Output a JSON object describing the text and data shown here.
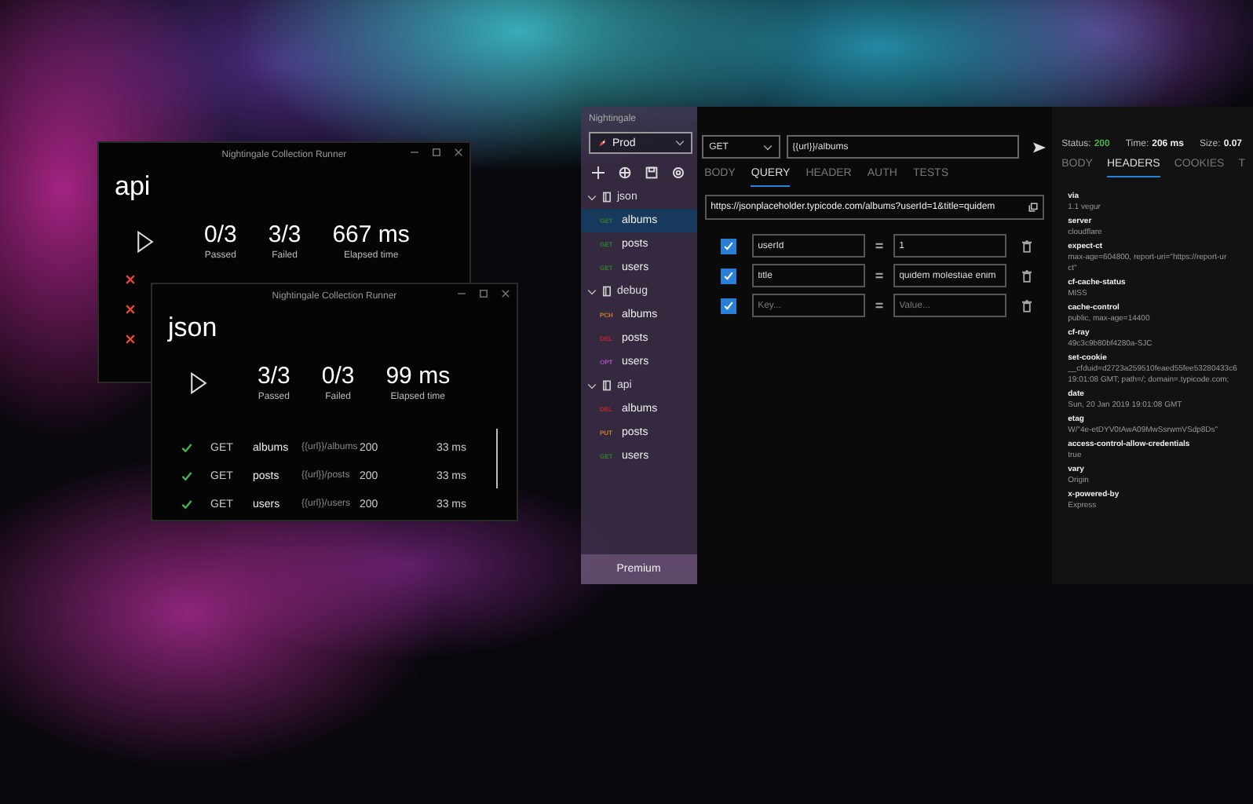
{
  "runners": [
    {
      "title": "Nightingale Collection Runner",
      "name": "api",
      "stats": [
        {
          "value": "0/3",
          "label": "Passed"
        },
        {
          "value": "3/3",
          "label": "Failed"
        },
        {
          "value": "667 ms",
          "label": "Elapsed time"
        }
      ],
      "results": [
        {
          "passed": false
        },
        {
          "passed": false
        },
        {
          "passed": false
        }
      ]
    },
    {
      "title": "Nightingale Collection Runner",
      "name": "json",
      "stats": [
        {
          "value": "3/3",
          "label": "Passed"
        },
        {
          "value": "0/3",
          "label": "Failed"
        },
        {
          "value": "99 ms",
          "label": "Elapsed time"
        }
      ],
      "results": [
        {
          "passed": true,
          "method": "GET",
          "name": "albums",
          "url": "{{url}}/albums",
          "code": "200",
          "time": "33 ms"
        },
        {
          "passed": true,
          "method": "GET",
          "name": "posts",
          "url": "{{url}}/posts",
          "code": "200",
          "time": "33 ms"
        },
        {
          "passed": true,
          "method": "GET",
          "name": "users",
          "url": "{{url}}/users",
          "code": "200",
          "time": "33 ms"
        }
      ]
    }
  ],
  "main": {
    "title": "Nightingale",
    "environment": "Prod",
    "collections": [
      {
        "name": "json",
        "expanded": true,
        "requests": [
          {
            "method": "GET",
            "color": "#2e7d32",
            "name": "albums",
            "selected": true
          },
          {
            "method": "GET",
            "color": "#2e7d32",
            "name": "posts",
            "selected": false
          },
          {
            "method": "GET",
            "color": "#2e7d32",
            "name": "users",
            "selected": false
          }
        ]
      },
      {
        "name": "debug",
        "expanded": true,
        "requests": [
          {
            "method": "PCH",
            "color": "#c77a2e",
            "name": "albums",
            "selected": false
          },
          {
            "method": "DEL",
            "color": "#b3262e",
            "name": "posts",
            "selected": false
          },
          {
            "method": "OPT",
            "color": "#a64fc0",
            "name": "users",
            "selected": false
          }
        ]
      },
      {
        "name": "api",
        "expanded": true,
        "requests": [
          {
            "method": "DEL",
            "color": "#b3262e",
            "name": "albums",
            "selected": false
          },
          {
            "method": "PUT",
            "color": "#c77a2e",
            "name": "posts",
            "selected": false
          },
          {
            "method": "GET",
            "color": "#2e7d32",
            "name": "users",
            "selected": false
          }
        ]
      }
    ],
    "premium": "Premium",
    "request": {
      "method": "GET",
      "url": "{{url}}/albums",
      "tabs": [
        {
          "label": "BODY",
          "selected": false
        },
        {
          "label": "QUERY",
          "selected": true
        },
        {
          "label": "HEADER",
          "selected": false
        },
        {
          "label": "AUTH",
          "selected": false
        },
        {
          "label": "TESTS",
          "selected": false
        }
      ],
      "full_url": "https://jsonplaceholder.typicode.com/albums?userId=1&title=quidem",
      "params": [
        {
          "checked": true,
          "key": "userId",
          "value": "1"
        },
        {
          "checked": true,
          "key": "title",
          "value": "quidem molestiae enim"
        },
        {
          "checked": true,
          "key_placeholder": "Key...",
          "value_placeholder": "Value..."
        }
      ]
    },
    "response": {
      "status_label": "Status:",
      "status": "200",
      "time_label": "Time:",
      "time": "206 ms",
      "size_label": "Size:",
      "size": "0.07",
      "tabs": [
        {
          "label": "BODY",
          "selected": false
        },
        {
          "label": "HEADERS",
          "selected": true
        },
        {
          "label": "COOKIES",
          "selected": false
        },
        {
          "label": "T",
          "selected": false
        }
      ],
      "headers": [
        {
          "name": "via",
          "lines": [
            "1.1 vegur"
          ]
        },
        {
          "name": "server",
          "lines": [
            "cloudflare"
          ]
        },
        {
          "name": "expect-ct",
          "lines": [
            "max-age=604800, report-uri=\"https://report-ur",
            "ct\""
          ]
        },
        {
          "name": "cf-cache-status",
          "lines": [
            "MISS"
          ]
        },
        {
          "name": "cache-control",
          "lines": [
            "public, max-age=14400"
          ]
        },
        {
          "name": "cf-ray",
          "lines": [
            "49c3c9b80bf4280a-SJC"
          ]
        },
        {
          "name": "set-cookie",
          "lines": [
            "__cfduid=d2723a259510feaed55fee53280433c6",
            "19:01:08 GMT; path=/; domain=.typicode.com;"
          ]
        },
        {
          "name": "date",
          "lines": [
            "Sun, 20 Jan 2019 19:01:08 GMT"
          ]
        },
        {
          "name": "etag",
          "lines": [
            "W/\"4e-etDYV0tAwA09MwSsrwmVSdp8Ds\""
          ]
        },
        {
          "name": "access-control-allow-credentials",
          "lines": [
            "true"
          ]
        },
        {
          "name": "vary",
          "lines": [
            "Origin"
          ]
        },
        {
          "name": "x-powered-by",
          "lines": [
            "Express"
          ]
        }
      ]
    }
  }
}
